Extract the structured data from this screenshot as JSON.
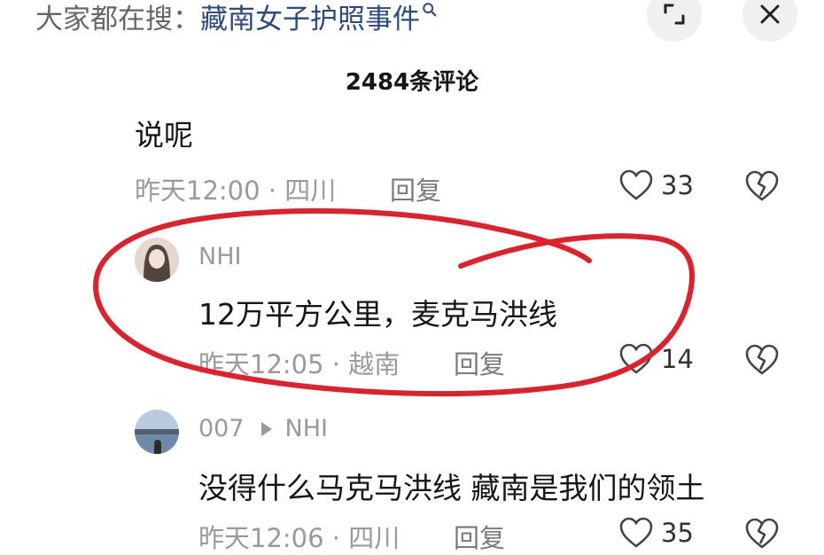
{
  "header": {
    "search_prefix": "大家都在搜：",
    "search_query": "藏南女子护照事件",
    "comment_count_title": "2484条评论"
  },
  "comments": [
    {
      "text": "说呢",
      "time": "昨天12:00",
      "location": "四川",
      "reply_label": "回复",
      "likes": "33"
    },
    {
      "user": "NHI",
      "text": "12万平方公里，麦克马洪线",
      "time": "昨天12:05",
      "location": "越南",
      "reply_label": "回复",
      "likes": "14"
    },
    {
      "user": "007",
      "reply_to": "NHI",
      "text": "没得什么马克马洪线 藏南是我们的领土",
      "time": "昨天12:06",
      "location": "四川",
      "reply_label": "回复",
      "likes": "35"
    }
  ],
  "meta_separator": "·",
  "colors": {
    "annotation_circle": "#e0202a",
    "search_link": "#2b4a82"
  }
}
